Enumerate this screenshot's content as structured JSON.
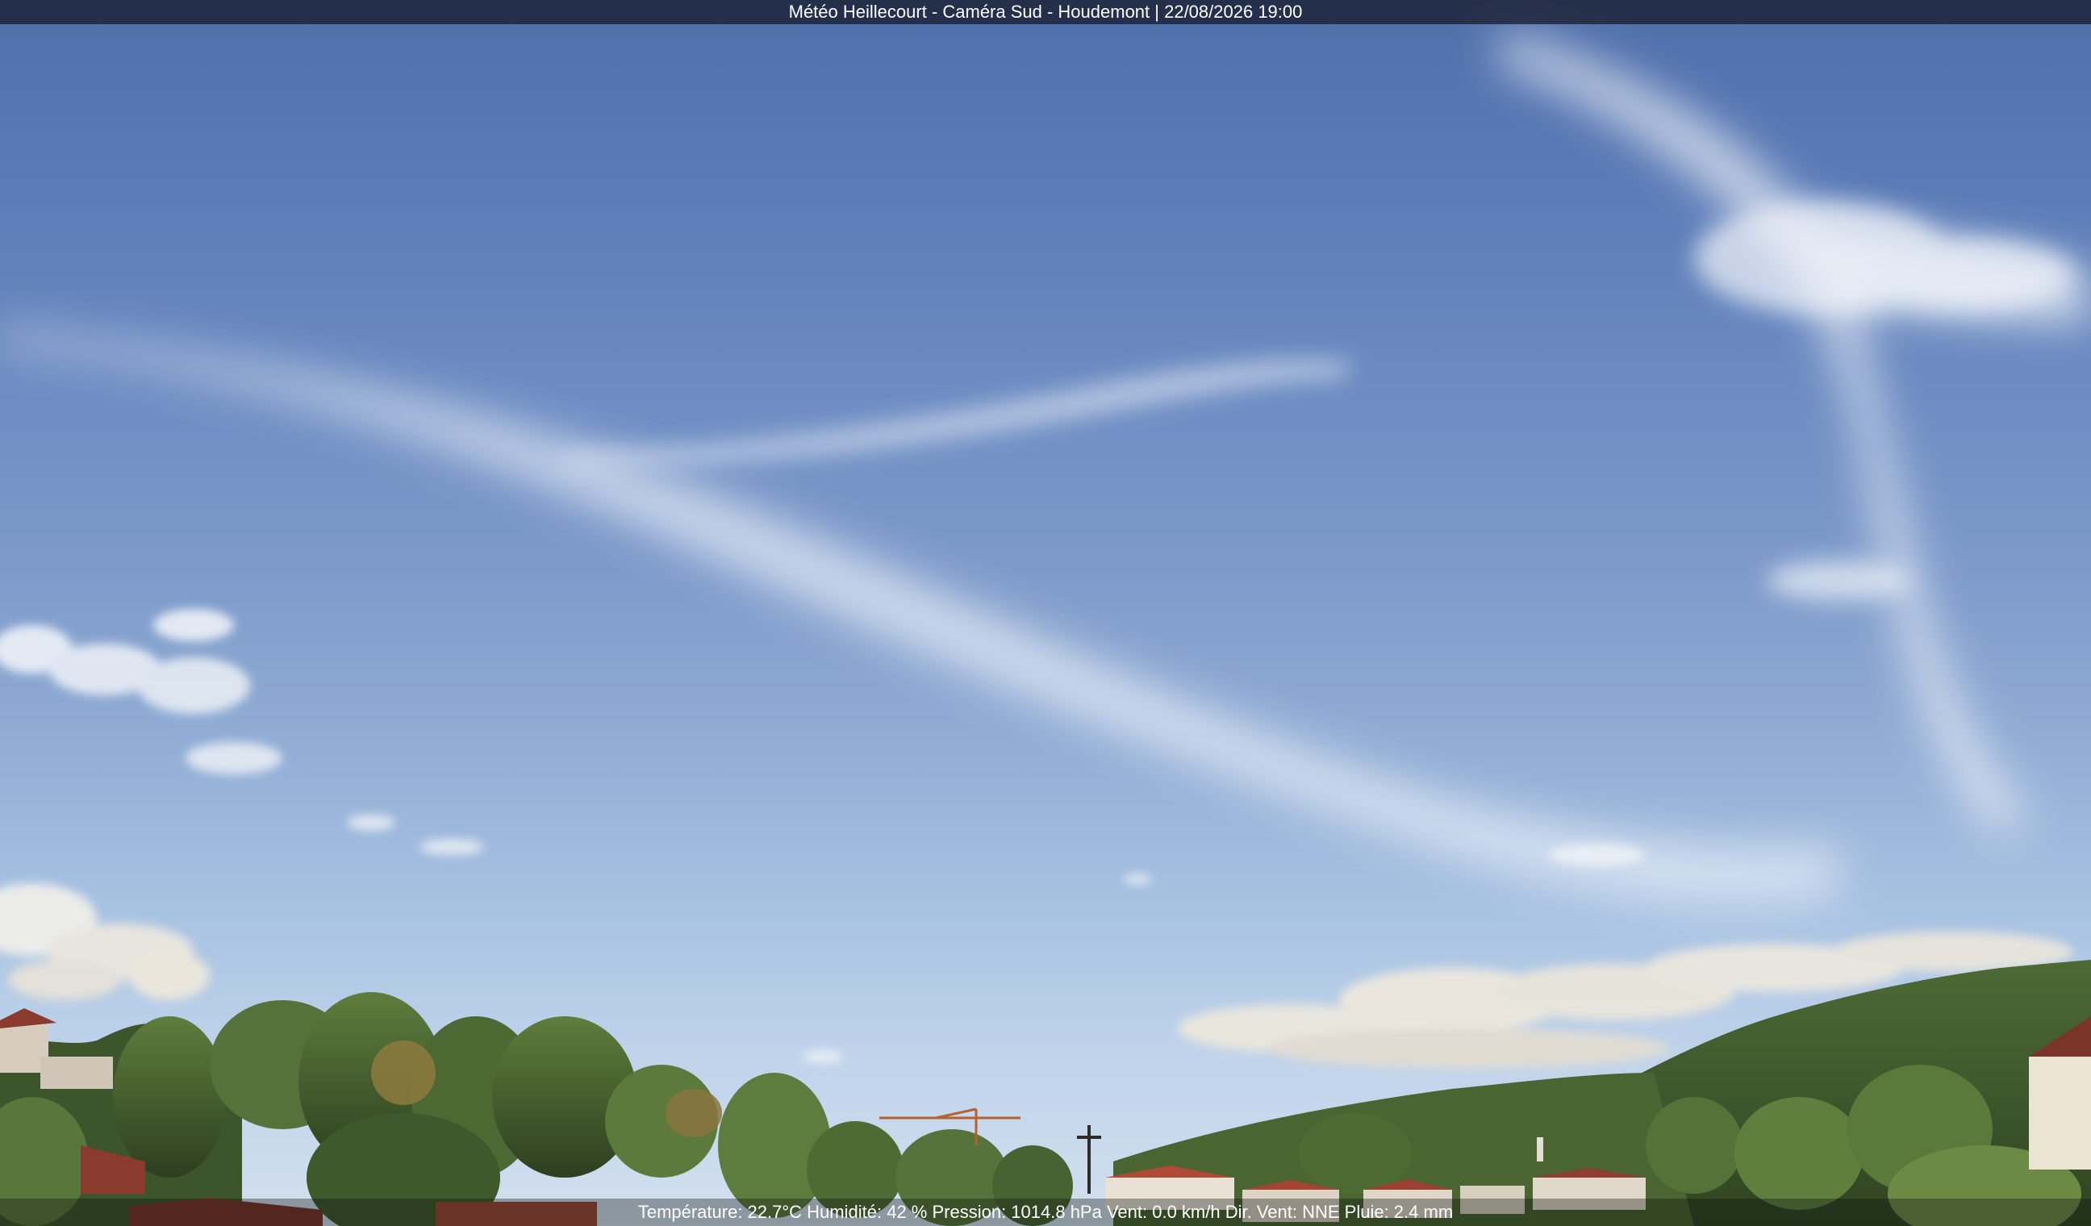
{
  "overlay": {
    "title": "Météo Heillecourt - Caméra Sud - Houdemont | 22/08/2026 19:00"
  },
  "readout": {
    "temperature": "Température: 22.7°C ",
    "humidity": "Humidité: 42 % ",
    "pressure": "Pression: 1014.8 hPa ",
    "wind": "Vent: 0.0 km/h ",
    "wind_dir": "Dir. Vent: NNE ",
    "rain": "Pluie: 2.4 mm"
  },
  "colors": {
    "sky_top": "#4f6faa",
    "sky_horizon": "#d3e0ee",
    "foliage_dark": "#3e5a2c",
    "foliage_light": "#6d8a45",
    "roof": "#8a3b2e"
  }
}
